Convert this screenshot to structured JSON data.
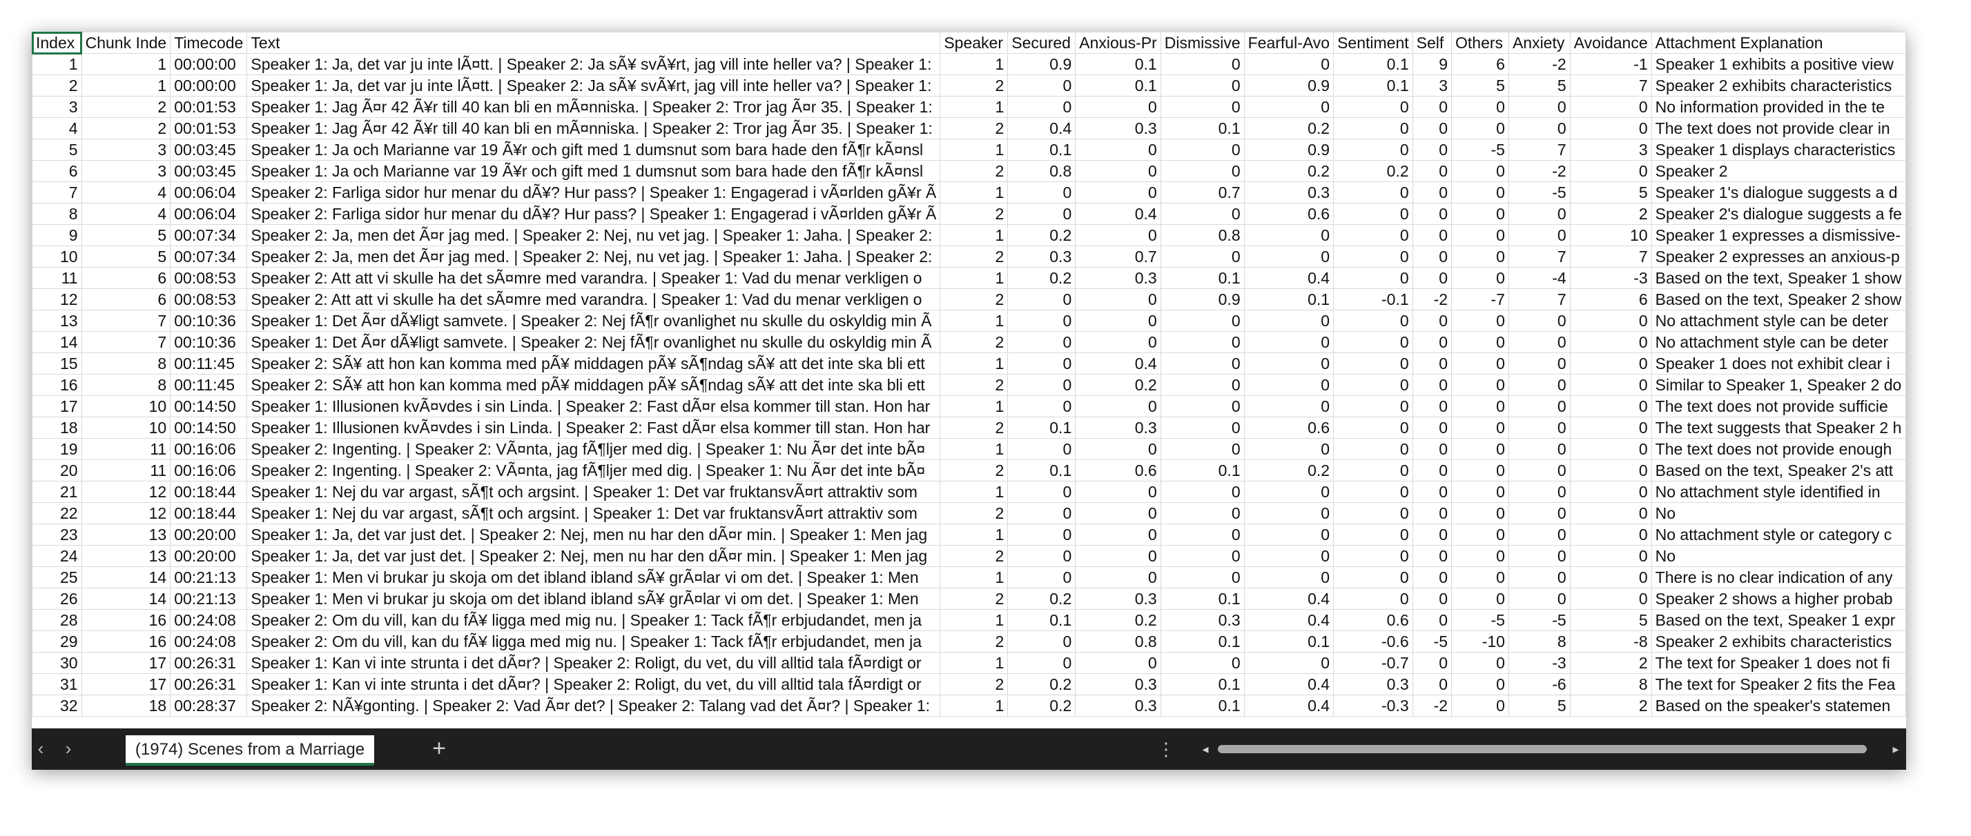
{
  "sheet_tab": {
    "label": "(1974) Scenes from a Marriage"
  },
  "icons": {
    "nav_left": "chevron-left-icon",
    "nav_right": "chevron-right-icon",
    "add": "plus-icon",
    "menu": "more-vertical-icon"
  },
  "colors": {
    "accent": "#217346",
    "tabbar": "#1f1f1f"
  },
  "headers": [
    "Index",
    "Chunk Inde",
    "Timecode",
    "Text",
    "Speaker",
    "Secured",
    "Anxious-Pr",
    "Dismissive",
    "Fearful-Avo",
    "Sentiment",
    "Self",
    "Others",
    "Anxiety",
    "Avoidance",
    "Attachment Explanation"
  ],
  "rows": [
    [
      "1",
      "1",
      "00:00:00",
      "Speaker 1: Ja, det var ju inte lÃ¤tt. | Speaker 2: Ja sÃ¥ svÃ¥rt, jag vill inte heller va? | Speaker 1:",
      "1",
      "0.9",
      "0.1",
      "0",
      "0",
      "0.1",
      "9",
      "6",
      "-2",
      "-1",
      "Speaker 1 exhibits a positive view"
    ],
    [
      "2",
      "1",
      "00:00:00",
      "Speaker 1: Ja, det var ju inte lÃ¤tt. | Speaker 2: Ja sÃ¥ svÃ¥rt, jag vill inte heller va? | Speaker 1:",
      "2",
      "0",
      "0.1",
      "0",
      "0.9",
      "0.1",
      "3",
      "5",
      "5",
      "7",
      "Speaker 2 exhibits characteristics"
    ],
    [
      "3",
      "2",
      "00:01:53",
      "Speaker 1: Jag Ã¤r 42 Ã¥r till 40 kan bli en mÃ¤nniska. | Speaker 2: Tror jag Ã¤r 35. | Speaker 1:",
      "1",
      "0",
      "0",
      "0",
      "0",
      "0",
      "0",
      "0",
      "0",
      "0",
      "No information provided in the te"
    ],
    [
      "4",
      "2",
      "00:01:53",
      "Speaker 1: Jag Ã¤r 42 Ã¥r till 40 kan bli en mÃ¤nniska. | Speaker 2: Tror jag Ã¤r 35. | Speaker 1:",
      "2",
      "0.4",
      "0.3",
      "0.1",
      "0.2",
      "0",
      "0",
      "0",
      "0",
      "0",
      "The text does not provide clear in"
    ],
    [
      "5",
      "3",
      "00:03:45",
      "Speaker 1: Ja och Marianne var 19 Ã¥r och gift med 1 dumsnut som bara hade den fÃ¶r kÃ¤nsl",
      "1",
      "0.1",
      "0",
      "0",
      "0.9",
      "0",
      "0",
      "-5",
      "7",
      "3",
      "Speaker 1 displays characteristics"
    ],
    [
      "6",
      "3",
      "00:03:45",
      "Speaker 1: Ja och Marianne var 19 Ã¥r och gift med 1 dumsnut som bara hade den fÃ¶r kÃ¤nsl",
      "2",
      "0.8",
      "0",
      "0",
      "0.2",
      "0.2",
      "0",
      "0",
      "-2",
      "0",
      "Speaker 2"
    ],
    [
      "7",
      "4",
      "00:06:04",
      "Speaker 2: Farliga sidor hur menar du dÃ¥? Hur pass? | Speaker 1: Engagerad i vÃ¤rlden gÃ¥r Ã",
      "1",
      "0",
      "0",
      "0.7",
      "0.3",
      "0",
      "0",
      "0",
      "-5",
      "5",
      "Speaker 1's dialogue suggests a d"
    ],
    [
      "8",
      "4",
      "00:06:04",
      "Speaker 2: Farliga sidor hur menar du dÃ¥? Hur pass? | Speaker 1: Engagerad i vÃ¤rlden gÃ¥r Ã",
      "2",
      "0",
      "0.4",
      "0",
      "0.6",
      "0",
      "0",
      "0",
      "0",
      "2",
      "Speaker 2's dialogue suggests a fe"
    ],
    [
      "9",
      "5",
      "00:07:34",
      "Speaker 2: Ja, men det Ã¤r jag med. | Speaker 2: Nej, nu vet jag. | Speaker 1: Jaha. | Speaker 2:",
      "1",
      "0.2",
      "0",
      "0.8",
      "0",
      "0",
      "0",
      "0",
      "0",
      "10",
      "Speaker 1 expresses a dismissive-"
    ],
    [
      "10",
      "5",
      "00:07:34",
      "Speaker 2: Ja, men det Ã¤r jag med. | Speaker 2: Nej, nu vet jag. | Speaker 1: Jaha. | Speaker 2:",
      "2",
      "0.3",
      "0.7",
      "0",
      "0",
      "0",
      "0",
      "0",
      "7",
      "7",
      "Speaker 2 expresses an anxious-p"
    ],
    [
      "11",
      "6",
      "00:08:53",
      "Speaker 2: Att att vi skulle ha det sÃ¤mre med varandra. | Speaker 1: Vad du menar verkligen o",
      "1",
      "0.2",
      "0.3",
      "0.1",
      "0.4",
      "0",
      "0",
      "0",
      "-4",
      "-3",
      "Based on the text, Speaker 1 show"
    ],
    [
      "12",
      "6",
      "00:08:53",
      "Speaker 2: Att att vi skulle ha det sÃ¤mre med varandra. | Speaker 1: Vad du menar verkligen o",
      "2",
      "0",
      "0",
      "0.9",
      "0.1",
      "-0.1",
      "-2",
      "-7",
      "7",
      "6",
      "Based on the text, Speaker 2 show"
    ],
    [
      "13",
      "7",
      "00:10:36",
      "Speaker 1: Det Ã¤r dÃ¥ligt samvete. | Speaker 2: Nej fÃ¶r ovanlighet nu skulle du oskyldig min Ã",
      "1",
      "0",
      "0",
      "0",
      "0",
      "0",
      "0",
      "0",
      "0",
      "0",
      "No attachment style can be deter"
    ],
    [
      "14",
      "7",
      "00:10:36",
      "Speaker 1: Det Ã¤r dÃ¥ligt samvete. | Speaker 2: Nej fÃ¶r ovanlighet nu skulle du oskyldig min Ã",
      "2",
      "0",
      "0",
      "0",
      "0",
      "0",
      "0",
      "0",
      "0",
      "0",
      "No attachment style can be deter"
    ],
    [
      "15",
      "8",
      "00:11:45",
      "Speaker 2: SÃ¥ att hon kan komma med pÃ¥ middagen pÃ¥ sÃ¶ndag sÃ¥ att det inte ska bli ett",
      "1",
      "0",
      "0.4",
      "0",
      "0",
      "0",
      "0",
      "0",
      "0",
      "0",
      "Speaker 1 does not exhibit clear i"
    ],
    [
      "16",
      "8",
      "00:11:45",
      "Speaker 2: SÃ¥ att hon kan komma med pÃ¥ middagen pÃ¥ sÃ¶ndag sÃ¥ att det inte ska bli ett",
      "2",
      "0",
      "0.2",
      "0",
      "0",
      "0",
      "0",
      "0",
      "0",
      "0",
      "Similar to Speaker 1, Speaker 2 do"
    ],
    [
      "17",
      "10",
      "00:14:50",
      "Speaker 1: Illusionen kvÃ¤vdes i sin Linda. | Speaker 2: Fast dÃ¤r elsa kommer till stan. Hon har",
      "1",
      "0",
      "0",
      "0",
      "0",
      "0",
      "0",
      "0",
      "0",
      "0",
      "The text does not provide sufficie"
    ],
    [
      "18",
      "10",
      "00:14:50",
      "Speaker 1: Illusionen kvÃ¤vdes i sin Linda. | Speaker 2: Fast dÃ¤r elsa kommer till stan. Hon har",
      "2",
      "0.1",
      "0.3",
      "0",
      "0.6",
      "0",
      "0",
      "0",
      "0",
      "0",
      "The text suggests that Speaker 2 h"
    ],
    [
      "19",
      "11",
      "00:16:06",
      "Speaker 2: Ingenting. | Speaker 2: VÃ¤nta, jag fÃ¶ljer med dig. | Speaker 1: Nu Ã¤r det inte bÃ¤",
      "1",
      "0",
      "0",
      "0",
      "0",
      "0",
      "0",
      "0",
      "0",
      "0",
      "The text does not provide enough"
    ],
    [
      "20",
      "11",
      "00:16:06",
      "Speaker 2: Ingenting. | Speaker 2: VÃ¤nta, jag fÃ¶ljer med dig. | Speaker 1: Nu Ã¤r det inte bÃ¤",
      "2",
      "0.1",
      "0.6",
      "0.1",
      "0.2",
      "0",
      "0",
      "0",
      "0",
      "0",
      "Based on the text, Speaker 2's att"
    ],
    [
      "21",
      "12",
      "00:18:44",
      "Speaker 1: Nej du var argast, sÃ¶t och argsint. | Speaker 1: Det var fruktansvÃ¤rt attraktiv som",
      "1",
      "0",
      "0",
      "0",
      "0",
      "0",
      "0",
      "0",
      "0",
      "0",
      "No attachment style identified in"
    ],
    [
      "22",
      "12",
      "00:18:44",
      "Speaker 1: Nej du var argast, sÃ¶t och argsint. | Speaker 1: Det var fruktansvÃ¤rt attraktiv som",
      "2",
      "0",
      "0",
      "0",
      "0",
      "0",
      "0",
      "0",
      "0",
      "0",
      "No"
    ],
    [
      "23",
      "13",
      "00:20:00",
      "Speaker 1: Ja, det var just det. | Speaker 2: Nej, men nu har den dÃ¤r min. | Speaker 1: Men jag",
      "1",
      "0",
      "0",
      "0",
      "0",
      "0",
      "0",
      "0",
      "0",
      "0",
      "No attachment style or category c"
    ],
    [
      "24",
      "13",
      "00:20:00",
      "Speaker 1: Ja, det var just det. | Speaker 2: Nej, men nu har den dÃ¤r min. | Speaker 1: Men jag",
      "2",
      "0",
      "0",
      "0",
      "0",
      "0",
      "0",
      "0",
      "0",
      "0",
      "No"
    ],
    [
      "25",
      "14",
      "00:21:13",
      "Speaker 1: Men vi brukar ju skoja om det ibland ibland sÃ¥ grÃ¤lar vi om det. | Speaker 1: Men",
      "1",
      "0",
      "0",
      "0",
      "0",
      "0",
      "0",
      "0",
      "0",
      "0",
      "There is no clear indication of any"
    ],
    [
      "26",
      "14",
      "00:21:13",
      "Speaker 1: Men vi brukar ju skoja om det ibland ibland sÃ¥ grÃ¤lar vi om det. | Speaker 1: Men",
      "2",
      "0.2",
      "0.3",
      "0.1",
      "0.4",
      "0",
      "0",
      "0",
      "0",
      "0",
      "Speaker 2 shows a higher probab"
    ],
    [
      "28",
      "16",
      "00:24:08",
      "Speaker 2: Om du vill, kan du fÃ¥ ligga med mig nu. | Speaker 1: Tack fÃ¶r erbjudandet, men ja",
      "1",
      "0.1",
      "0.2",
      "0.3",
      "0.4",
      "0.6",
      "0",
      "-5",
      "-5",
      "5",
      "Based on the text, Speaker 1 expr"
    ],
    [
      "29",
      "16",
      "00:24:08",
      "Speaker 2: Om du vill, kan du fÃ¥ ligga med mig nu. | Speaker 1: Tack fÃ¶r erbjudandet, men ja",
      "2",
      "0",
      "0.8",
      "0.1",
      "0.1",
      "-0.6",
      "-5",
      "-10",
      "8",
      "-8",
      "Speaker 2 exhibits characteristics"
    ],
    [
      "30",
      "17",
      "00:26:31",
      "Speaker 1: Kan vi inte strunta i det dÃ¤r? | Speaker 2: Roligt, du vet, du vill alltid tala fÃ¤rdigt or",
      "1",
      "0",
      "0",
      "0",
      "0",
      "-0.7",
      "0",
      "0",
      "-3",
      "2",
      "The text for Speaker 1 does not fi"
    ],
    [
      "31",
      "17",
      "00:26:31",
      "Speaker 1: Kan vi inte strunta i det dÃ¤r? | Speaker 2: Roligt, du vet, du vill alltid tala fÃ¤rdigt or",
      "2",
      "0.2",
      "0.3",
      "0.1",
      "0.4",
      "0.3",
      "0",
      "0",
      "-6",
      "8",
      "The text for Speaker 2 fits the Fea"
    ],
    [
      "32",
      "18",
      "00:28:37",
      "Speaker 2: NÃ¥gonting. | Speaker 2: Vad Ã¤r det? | Speaker 2: Talang vad det Ã¤r? | Speaker 1:",
      "1",
      "0.2",
      "0.3",
      "0.1",
      "0.4",
      "-0.3",
      "-2",
      "0",
      "5",
      "2",
      "Based on the speaker's statemen"
    ]
  ]
}
